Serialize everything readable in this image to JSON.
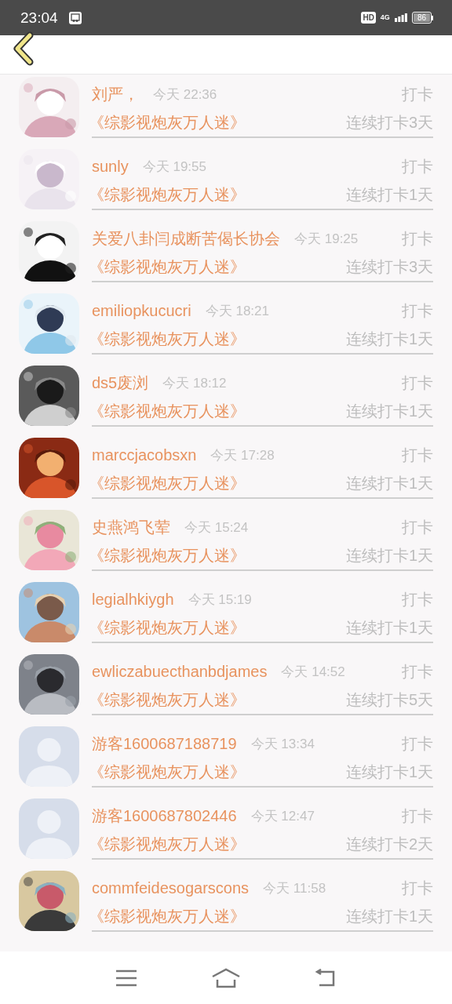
{
  "status_bar": {
    "time": "23:04",
    "hd_badge": "HD",
    "network": "4G",
    "battery": "86"
  },
  "entries": [
    {
      "user": "刘严，",
      "time": "今天 22:36",
      "action": "打卡",
      "book": "《综影视炮灰万人迷》",
      "streak": "连续打卡3天"
    },
    {
      "user": "sunly",
      "time": "今天 19:55",
      "action": "打卡",
      "book": "《综影视炮灰万人迷》",
      "streak": "连续打卡1天"
    },
    {
      "user": "关爱八卦闫成断苦偈长协会",
      "time": "今天 19:25",
      "action": "打卡",
      "book": "《综影视炮灰万人迷》",
      "streak": "连续打卡3天"
    },
    {
      "user": "emiliopkucucri",
      "time": "今天 18:21",
      "action": "打卡",
      "book": "《综影视炮灰万人迷》",
      "streak": "连续打卡1天"
    },
    {
      "user": "ds5废浏",
      "time": "今天 18:12",
      "action": "打卡",
      "book": "《综影视炮灰万人迷》",
      "streak": "连续打卡1天"
    },
    {
      "user": "marccjacobsxn",
      "time": "今天 17:28",
      "action": "打卡",
      "book": "《综影视炮灰万人迷》",
      "streak": "连续打卡1天"
    },
    {
      "user": "史燕鸿飞荤",
      "time": "今天 15:24",
      "action": "打卡",
      "book": "《综影视炮灰万人迷》",
      "streak": "连续打卡1天"
    },
    {
      "user": "legialhkiygh",
      "time": "今天 15:19",
      "action": "打卡",
      "book": "《综影视炮灰万人迷》",
      "streak": "连续打卡1天"
    },
    {
      "user": "ewliczabuecthanbdjames",
      "time": "今天 14:52",
      "action": "打卡",
      "book": "《综影视炮灰万人迷》",
      "streak": "连续打卡5天"
    },
    {
      "user": "游客1600687188719",
      "time": "今天 13:34",
      "action": "打卡",
      "book": "《综影视炮灰万人迷》",
      "streak": "连续打卡1天",
      "avatar": {
        "kind": "silhouette"
      }
    },
    {
      "user": "游客1600687802446",
      "time": "今天 12:47",
      "action": "打卡",
      "book": "《综影视炮灰万人迷》",
      "streak": "连续打卡2天",
      "avatar": {
        "kind": "silhouette"
      }
    },
    {
      "user": "commfeidesogarscons",
      "time": "今天 11:58",
      "action": "打卡",
      "book": "《综影视炮灰万人迷》",
      "streak": "连续打卡1天"
    }
  ]
}
